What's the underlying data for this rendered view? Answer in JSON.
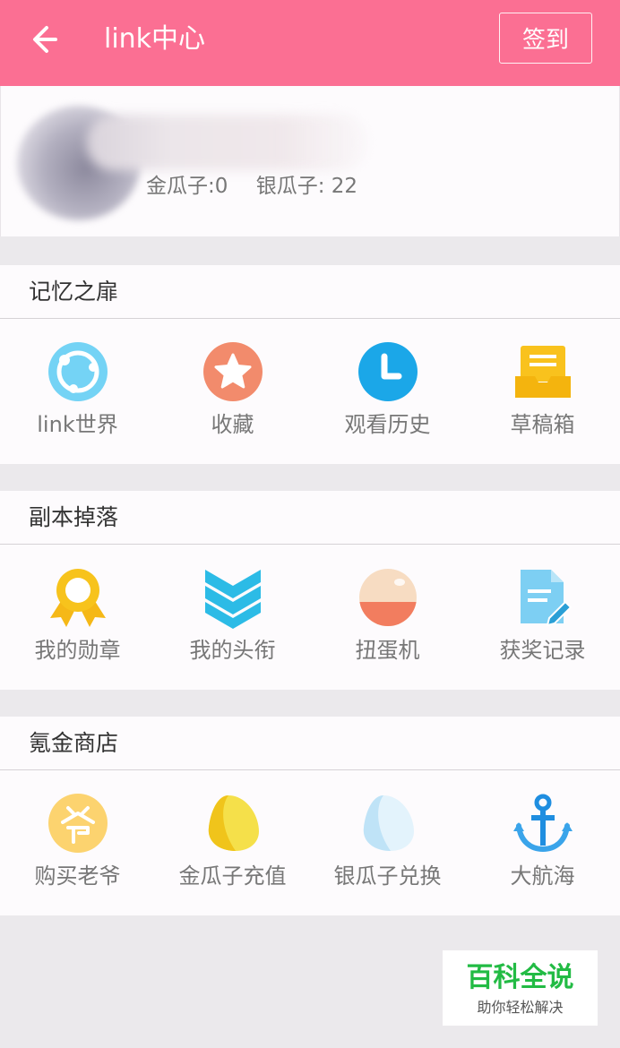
{
  "header": {
    "title": "link中心",
    "checkin_label": "签到",
    "color": "#fb6f93"
  },
  "profile": {
    "gold_text": "金瓜子:0",
    "silver_text": "银瓜子: 22"
  },
  "sections": [
    {
      "title": "记忆之扉",
      "items": [
        {
          "label": "link世界",
          "icon": "link-world-icon"
        },
        {
          "label": "收藏",
          "icon": "favorite-star-icon"
        },
        {
          "label": "观看历史",
          "icon": "clock-history-icon"
        },
        {
          "label": "草稿箱",
          "icon": "draft-box-icon"
        }
      ]
    },
    {
      "title": "副本掉落",
      "items": [
        {
          "label": "我的勋章",
          "icon": "medal-icon"
        },
        {
          "label": "我的头衔",
          "icon": "chevron-rank-icon"
        },
        {
          "label": "扭蛋机",
          "icon": "capsule-egg-icon"
        },
        {
          "label": "获奖记录",
          "icon": "award-record-icon"
        }
      ]
    },
    {
      "title": "氪金商店",
      "items": [
        {
          "label": "购买老爷",
          "icon": "vip-lord-icon"
        },
        {
          "label": "金瓜子充值",
          "icon": "gold-seed-icon"
        },
        {
          "label": "银瓜子兑换",
          "icon": "silver-seed-icon"
        },
        {
          "label": "大航海",
          "icon": "anchor-icon"
        }
      ]
    }
  ],
  "watermark": {
    "title": "百科全说",
    "subtitle": "助你轻松解决"
  }
}
